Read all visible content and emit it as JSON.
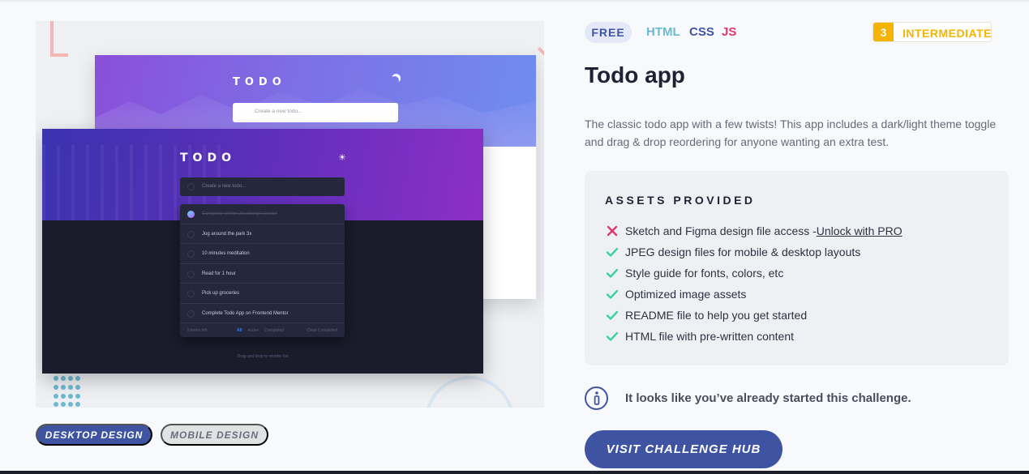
{
  "preview": {
    "light": {
      "title": "TODO",
      "input_placeholder": "Create a new todo..."
    },
    "dark": {
      "title": "TODO",
      "input_placeholder": "Create a new todo...",
      "items": [
        {
          "label": "Complete online JavaScript course",
          "done": true
        },
        {
          "label": "Jog around the park 3x",
          "done": false
        },
        {
          "label": "10 minutes meditation",
          "done": false
        },
        {
          "label": "Read for 1 hour",
          "done": false
        },
        {
          "label": "Pick up groceries",
          "done": false
        },
        {
          "label": "Complete Todo App on Frontend Mentor",
          "done": false
        }
      ],
      "footer": {
        "items_left": "5 items left",
        "filter_all": "All",
        "filter_active": "Active",
        "filter_completed": "Completed",
        "clear": "Clear Completed"
      },
      "drag_hint": "Drag and drop to reorder list"
    }
  },
  "view_toggle": {
    "desktop_label": "DESKTOP DESIGN",
    "mobile_label": "MOBILE DESIGN",
    "selected": "desktop"
  },
  "challenge": {
    "price_tag": "FREE",
    "languages": [
      "HTML",
      "CSS",
      "JS"
    ],
    "level_number": "3",
    "level_label": "INTERMEDIATE",
    "title": "Todo app",
    "description": "The classic todo app with a few twists! This app includes a dark/light theme toggle and drag & drop reordering for anyone wanting an extra test."
  },
  "assets": {
    "heading": "ASSETS PROVIDED",
    "items": [
      {
        "label": "Sketch and Figma design file access - ",
        "link": "Unlock with PRO",
        "included": false,
        "icon": "cross-icon"
      },
      {
        "label": "JPEG design files for mobile & desktop layouts",
        "included": true,
        "icon": "check-icon"
      },
      {
        "label": "Style guide for fonts, colors, etc",
        "included": true,
        "icon": "check-icon"
      },
      {
        "label": "Optimized image assets",
        "included": true,
        "icon": "check-icon"
      },
      {
        "label": "README file to help you get started",
        "included": true,
        "icon": "check-icon"
      },
      {
        "label": "HTML file with pre-written content",
        "included": true,
        "icon": "check-icon"
      }
    ]
  },
  "notice": {
    "icon": "info-icon",
    "text": "It looks like you’ve already started this challenge."
  },
  "cta": {
    "label": "VISIT CHALLENGE HUB"
  },
  "colors": {
    "primary": "#3e54a3",
    "html": "#6cb9d1",
    "css": "#3e54a3",
    "js": "#e1376f",
    "level": "#f5b400",
    "check": "#3ed1a0",
    "cross": "#e1376f"
  }
}
